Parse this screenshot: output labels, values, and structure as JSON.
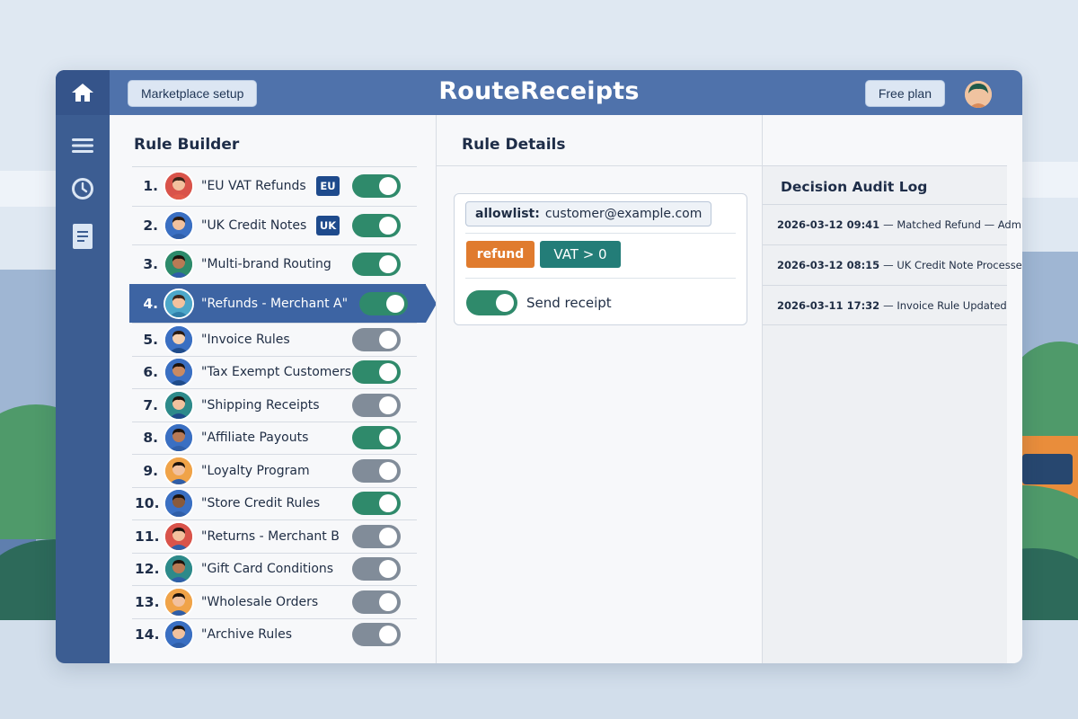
{
  "header": {
    "title": "RouteReceipts",
    "marketplace_button": "Marketplace setup",
    "plan_button": "Free plan"
  },
  "sidebar": {
    "icons": [
      "home-icon",
      "menu-icon",
      "clock-icon",
      "document-icon"
    ]
  },
  "rule_builder": {
    "title": "Rule Builder",
    "rules": [
      {
        "num": "1.",
        "name": "\"EU VAT Refunds",
        "badge": "EU",
        "enabled": true,
        "avatar_bg": "#d9534a",
        "skin": "#f2c19e",
        "hair": "#3a2418",
        "shirt": "#e25b4b"
      },
      {
        "num": "2.",
        "name": "\"UK Credit Notes",
        "badge": "UK",
        "enabled": true,
        "avatar_bg": "#3a6fc2",
        "skin": "#f2c19e",
        "hair": "#2a1a10",
        "shirt": "#2f5ea8"
      },
      {
        "num": "3.",
        "name": "\"Multi-brand Routing",
        "badge": "",
        "enabled": true,
        "avatar_bg": "#2d8a6a",
        "skin": "#b97a55",
        "hair": "#1c120c",
        "shirt": "#2f5ea8"
      },
      {
        "num": "4.",
        "name": "\"Refunds - Merchant A\"",
        "badge": "",
        "enabled": true,
        "selected": true,
        "avatar_bg": "#4ca7c9",
        "skin": "#f2c19e",
        "hair": "#3a2418",
        "shirt": "#2f7ea8"
      },
      {
        "num": "5.",
        "name": "\"Invoice Rules",
        "badge": "",
        "enabled": false,
        "avatar_bg": "#3a6fc2",
        "skin": "#f5d0b0",
        "hair": "#2a1a10",
        "shirt": "#1f4b8a"
      },
      {
        "num": "6.",
        "name": "\"Tax Exempt Customers",
        "badge": "",
        "enabled": true,
        "avatar_bg": "#3a6fc2",
        "skin": "#c98a62",
        "hair": "#1c120c",
        "shirt": "#1f4b8a"
      },
      {
        "num": "7.",
        "name": "\"Shipping Receipts",
        "badge": "",
        "enabled": false,
        "avatar_bg": "#2d8a8a",
        "skin": "#f2c19e",
        "hair": "#1c120c",
        "shirt": "#1f4b8a"
      },
      {
        "num": "8.",
        "name": "\"Affiliate Payouts",
        "badge": "",
        "enabled": true,
        "avatar_bg": "#3a6fc2",
        "skin": "#b97a55",
        "hair": "#1c120c",
        "shirt": "#2f5ea8"
      },
      {
        "num": "9.",
        "name": "\"Loyalty Program",
        "badge": "",
        "enabled": false,
        "avatar_bg": "#f0a348",
        "skin": "#f2c19e",
        "hair": "#1c120c",
        "shirt": "#2f5ea8"
      },
      {
        "num": "10.",
        "name": "\"Store Credit Rules",
        "badge": "",
        "enabled": true,
        "avatar_bg": "#3a6fc2",
        "skin": "#8a5a3a",
        "hair": "#1c120c",
        "shirt": "#2f5ea8"
      },
      {
        "num": "11.",
        "name": "\"Returns - Merchant B",
        "badge": "",
        "enabled": false,
        "avatar_bg": "#d9534a",
        "skin": "#f2c19e",
        "hair": "#1c120c",
        "shirt": "#2f5ea8"
      },
      {
        "num": "12.",
        "name": "\"Gift Card Conditions",
        "badge": "",
        "enabled": false,
        "avatar_bg": "#2d8a8a",
        "skin": "#b97a55",
        "hair": "#1c120c",
        "shirt": "#2f5ea8"
      },
      {
        "num": "13.",
        "name": "\"Wholesale Orders",
        "badge": "",
        "enabled": false,
        "avatar_bg": "#f0a348",
        "skin": "#f2c19e",
        "hair": "#1c120c",
        "shirt": "#2f5ea8"
      },
      {
        "num": "14.",
        "name": "\"Archive Rules",
        "badge": "",
        "enabled": false,
        "avatar_bg": "#3a6fc2",
        "skin": "#f2c19e",
        "hair": "#1c120c",
        "shirt": "#2f5ea8"
      }
    ]
  },
  "rule_details": {
    "title": "Rule Details",
    "allowlist_key": "allowlist:",
    "allowlist_value": "customer@example.com",
    "tag_refund": "refund",
    "tag_condition": "VAT > 0",
    "send_receipt_label": "Send receipt",
    "send_receipt_enabled": true
  },
  "audit_log": {
    "title": "Decision Audit Log",
    "entries": [
      {
        "timestamp": "2026-03-12 09:41",
        "text": "— Matched Refund — Admin"
      },
      {
        "timestamp": "2026-03-12 08:15",
        "text": "— UK Credit Note Processed"
      },
      {
        "timestamp": "2026-03-11 17:32",
        "text": "— Invoice Rule Updated"
      }
    ]
  },
  "colors": {
    "header_blue": "#4f72ab",
    "sidebar_blue": "#3c5d92",
    "toggle_on": "#2f8a6b",
    "toggle_off": "#818c99",
    "selected_row": "#3d64a3",
    "tag_refund": "#e07b2e",
    "tag_condition": "#237d78"
  }
}
